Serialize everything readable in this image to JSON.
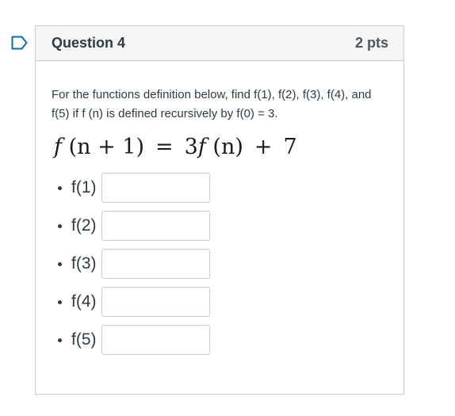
{
  "question": {
    "title": "Question 4",
    "points": "2 pts",
    "prompt": "For the functions definition below, find f(1), f(2), f(3), f(4), and f(5) if f (n) is defined recursively by f(0) = 3.",
    "formula": {
      "lhs_f": "f",
      "lhs_args": " (n + 1)",
      "equals": "=",
      "rhs_coef": "3",
      "rhs_f": "f",
      "rhs_args": " (n)",
      "plus": "+",
      "constant": "7"
    },
    "answers": [
      {
        "label": "f(1)",
        "value": ""
      },
      {
        "label": "f(2)",
        "value": ""
      },
      {
        "label": "f(3)",
        "value": ""
      },
      {
        "label": "f(4)",
        "value": ""
      },
      {
        "label": "f(5)",
        "value": ""
      }
    ]
  },
  "icons": {
    "flag": "bookmark-flag-icon"
  },
  "colors": {
    "flag_blue": "#0770a3",
    "header_bg": "#f5f5f5",
    "border": "#c7cdd1",
    "text": "#2d3b45"
  }
}
